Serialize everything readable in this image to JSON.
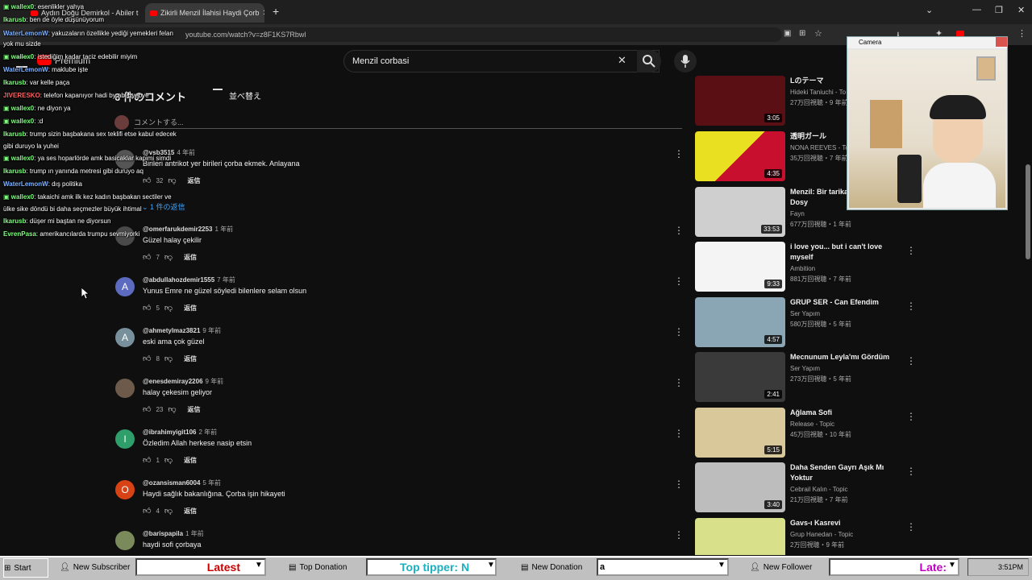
{
  "browser": {
    "tabs": [
      {
        "label": "Aydın Doğu Demirkol - Abiler t"
      },
      {
        "label": "Zikirli Menzil İlahisi Haydi Çorb"
      }
    ],
    "new_tab": "+",
    "url": "youtube.com/watch?v=z8F1KS7Rbwl"
  },
  "youtube": {
    "logo_badge": "Premium",
    "search": {
      "value": "Menzil corbasi"
    },
    "comments_header": {
      "count_label": "6  件のコメント",
      "sort_label": "並べ替え"
    },
    "add_comment": "コメントする...",
    "reply_label": "返信",
    "replies_toggle": "1 件の返信",
    "comments": [
      {
        "user": "@vsb3515",
        "time": "4 年前",
        "text": "Birileri antrikot yer birileri çorba ekmek. Anlayana",
        "likes": "32",
        "avatar_letter": "",
        "avatar_color": "#555555"
      },
      {
        "user": "@omerfarukdemir2253",
        "time": "1 年前",
        "text": "Güzel halay çekilir",
        "likes": "7",
        "avatar_letter": "",
        "avatar_color": "#4a4a4a"
      },
      {
        "user": "@abdullahozdemir1555",
        "time": "7 年前",
        "text": "Yunus Emre ne güzel söyledi bilenlere selam olsun",
        "likes": "5",
        "avatar_letter": "A",
        "avatar_color": "#5c6bc0"
      },
      {
        "user": "@ahmetylmaz3821",
        "time": "9 年前",
        "text": "eski ama çok güzel",
        "likes": "8",
        "avatar_letter": "A",
        "avatar_color": "#78909c"
      },
      {
        "user": "@enesdemiray2206",
        "time": "9 年前",
        "text": "halay çekesim geliyor",
        "likes": "23",
        "avatar_letter": "",
        "avatar_color": "#6d5a4a"
      },
      {
        "user": "@ibrahimyigit106",
        "time": "2 年前",
        "text": "Özledim Allah herkese nasip etsin",
        "likes": "1",
        "avatar_letter": "I",
        "avatar_color": "#2e9e6a"
      },
      {
        "user": "@ozansisman6004",
        "time": "5 年前",
        "text": "Haydi sağlık bakanlığına. Çorba işin hikayeti",
        "likes": "4",
        "avatar_letter": "O",
        "avatar_color": "#d84315"
      },
      {
        "user": "@barispapila",
        "time": "1 年前",
        "text": "haydi sofi çorbaya",
        "likes": "",
        "avatar_letter": "",
        "avatar_color": "#7a8a5a"
      }
    ],
    "videos": [
      {
        "title": "Lのテーマ",
        "channel": "Hideki Taniuchi - To",
        "stats": "27万回視聴・9 年前",
        "duration": "3:05",
        "thumb_color": "#5a0f14"
      },
      {
        "title": "透明ガール",
        "channel": "NONA REEVES - Top",
        "stats": "35万回視聴・7 年前",
        "duration": "4:35",
        "thumb_color": "#e8e020"
      },
      {
        "title": "Menzil: Bir tarika Fayn - Özel Dosy",
        "channel": "Fayn",
        "stats": "677万回視聴・1 年前",
        "duration": "33:53",
        "thumb_color": "#cfcfcf"
      },
      {
        "title": "i love you... but i can't love myself",
        "channel": "Ambition",
        "stats": "881万回視聴・7 年前",
        "duration": "9:33",
        "thumb_color": "#f4f4f4"
      },
      {
        "title": "GRUP SER - Can Efendim",
        "channel": "Ser Yapım",
        "stats": "580万回視聴・5 年前",
        "duration": "4:57",
        "thumb_color": "#8aa6b5"
      },
      {
        "title": "Mecnunum Leyla'mı Gördüm",
        "channel": "Ser Yapım",
        "stats": "273万回視聴・5 年前",
        "duration": "2:41",
        "thumb_color": "#3a3a3a"
      },
      {
        "title": "Ağlama Sofi",
        "channel": "Release - Topic",
        "stats": "45万回視聴・10 年前",
        "duration": "5:15",
        "thumb_color": "#d9c89a"
      },
      {
        "title": "Daha Senden Gayrı Aşık Mı Yoktur",
        "channel": "Cebrail Kalın - Topic",
        "stats": "21万回視聴・7 年前",
        "duration": "3:40",
        "thumb_color": "#bdbdbd"
      },
      {
        "title": "Gavs-ı Kasrevi",
        "channel": "Grup Hanedan - Topic",
        "stats": "2万回視聴・9 年前",
        "duration": "",
        "thumb_color": "#d8e08a"
      }
    ]
  },
  "chat": {
    "messages": [
      {
        "user": "wallex0",
        "text": "esenlikler yahya",
        "color": "#7fff7f",
        "badge": true
      },
      {
        "user": "Ikarusb",
        "text": "ben de öyle düşünüyorum",
        "color": "#7fff7f",
        "badge": false
      },
      {
        "user": "WaterLemonW",
        "text": "yakuzaların özellikle yediği yemekleri felan",
        "color": "#7fb2ff",
        "badge": false
      },
      {
        "user": "",
        "text": "yok mu sizde",
        "color": "#ffffff",
        "badge": false
      },
      {
        "user": "wallex0",
        "text": "istediğim kadar taciz edebilir miyim",
        "color": "#7fff7f",
        "badge": true
      },
      {
        "user": "WaterLemonW",
        "text": "maklube işte",
        "color": "#7fb2ff",
        "badge": false
      },
      {
        "user": "Ikarusb",
        "text": "var kelle paça",
        "color": "#7fff7f",
        "badge": false
      },
      {
        "user": "JIVERESKO",
        "text": "telefon kapanıyor hadi by abi byebye",
        "color": "#ff6060",
        "badge": false
      },
      {
        "user": "wallex0",
        "text": "ne diyon ya",
        "color": "#7fff7f",
        "badge": true
      },
      {
        "user": "wallex0",
        "text": ":d",
        "color": "#7fff7f",
        "badge": true
      },
      {
        "user": "Ikarusb",
        "text": "trump sizin başbakana sex teklifi etse kabul edecek",
        "color": "#7fff7f",
        "badge": false
      },
      {
        "user": "",
        "text": "gibi duruyo la yuhei",
        "color": "#ffffff",
        "badge": false
      },
      {
        "user": "wallex0",
        "text": "ya ses hoparlörde amk basicaklar kapimi simdi",
        "color": "#7fff7f",
        "badge": true
      },
      {
        "user": "Ikarusb",
        "text": "trump ın yanında metresi gibi duruyo aq",
        "color": "#7fff7f",
        "badge": false
      },
      {
        "user": "WaterLemonW",
        "text": "dış politika",
        "color": "#7fb2ff",
        "badge": false
      },
      {
        "user": "wallex0",
        "text": "takaichi amk ilk kez kadın başbakan sectiler ve",
        "color": "#7fff7f",
        "badge": true
      },
      {
        "user": "",
        "text": "ülke sike döndü bi daha seçmezler büyük ihtimal",
        "color": "#ffffff",
        "badge": false
      },
      {
        "user": "Ikarusb",
        "text": "düşer mi baştan ne diyorsun",
        "color": "#7fff7f",
        "badge": false
      },
      {
        "user": "EvrenPasa",
        "text": "amerikancılarda trumpu sevmiyorki",
        "color": "#7fff7f",
        "badge": false
      }
    ]
  },
  "camera": {
    "title": "Camera"
  },
  "taskbar": {
    "start": "Start",
    "new_subscriber": "New Subscriber",
    "latest": "Latest",
    "top_donation": "Top Donation",
    "top_tipper": "Top tipper: N",
    "new_donation": "New Donation",
    "donation_field": "a",
    "new_follower": "New Follower",
    "latest2": "Late:",
    "clock": "3:51PM"
  },
  "colors": {
    "accent": "#ff0000",
    "background": "#0f0f0f"
  }
}
